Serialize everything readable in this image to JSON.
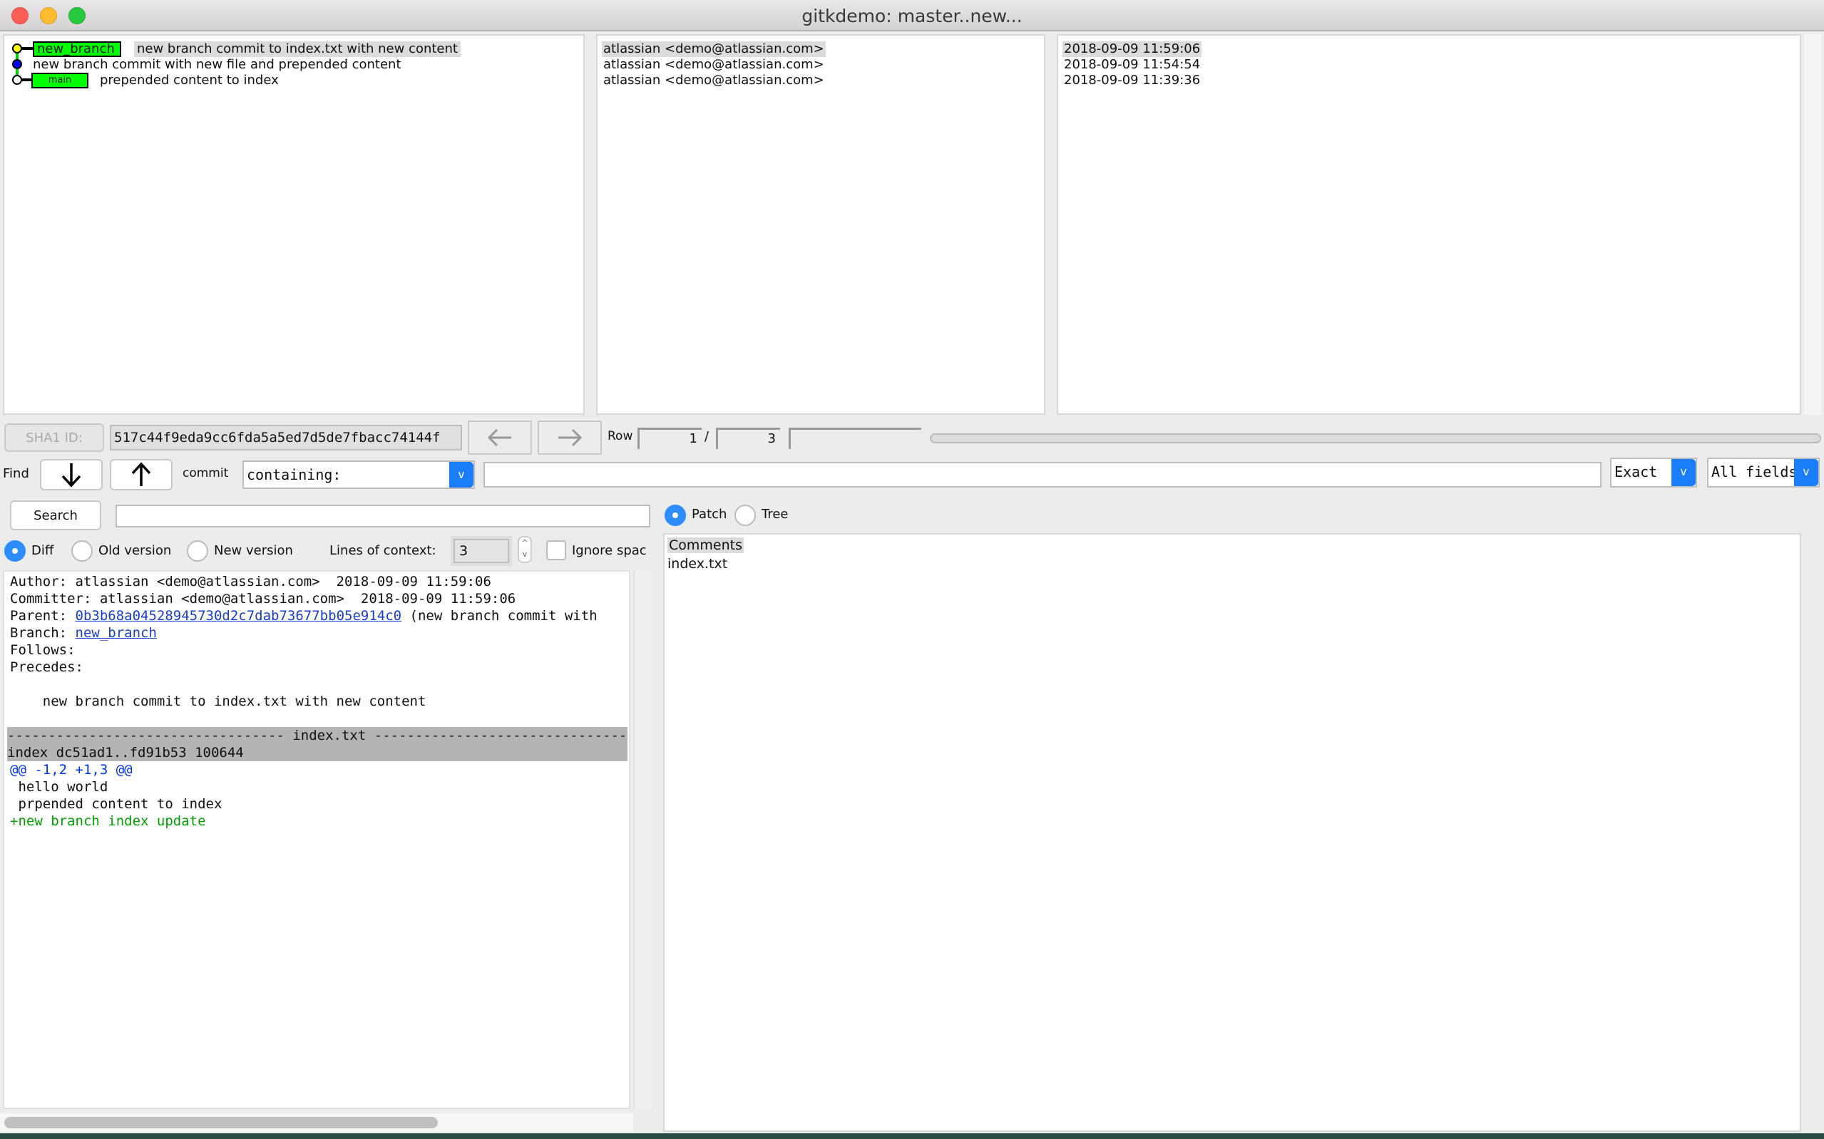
{
  "window": {
    "title": "gitkdemo: master..new...",
    "traffic_lights": [
      {
        "name": "close",
        "color": "#ff5f57"
      },
      {
        "name": "minimize",
        "color": "#febc2e"
      },
      {
        "name": "zoom",
        "color": "#28c840"
      }
    ]
  },
  "history": {
    "commits": [
      {
        "ref": "new_branch",
        "message": "new branch commit to index.txt with new content",
        "author": "atlassian <demo@atlassian.com>",
        "date": "2018-09-09 11:59:06",
        "node_color": "#ffff00",
        "selected": true
      },
      {
        "ref": "",
        "message": "new branch commit with new file and prepended content",
        "author": "atlassian <demo@atlassian.com>",
        "date": "2018-09-09 11:54:54",
        "node_color": "#0000ff",
        "selected": false
      },
      {
        "ref": "main",
        "message": "prepended content to index",
        "author": "atlassian <demo@atlassian.com>",
        "date": "2018-09-09 11:39:36",
        "node_color": "#ffffff",
        "selected": false
      }
    ],
    "branch_label_color": "#00ff00",
    "graph_line_color": "#00cc00"
  },
  "toolbar": {
    "sha1_label": "SHA1 ID:",
    "sha1_value": "517c44f9eda9cc6fda5a5ed7d5de7fbacc74144f",
    "back_icon": "arrow-left-icon",
    "forward_icon": "arrow-right-icon",
    "row_label": "Row",
    "row_current": "1",
    "row_separator": "/",
    "row_total": "3"
  },
  "find": {
    "label": "Find",
    "down_icon": "arrow-down-icon",
    "up_icon": "arrow-up-icon",
    "commit_label": "commit",
    "mode_value": "containing:",
    "query_value": "",
    "match_value": "Exact",
    "fields_value": "All fields"
  },
  "search": {
    "button_label": "Search",
    "input_value": ""
  },
  "diff_options": {
    "modes": [
      {
        "label": "Diff",
        "selected": true
      },
      {
        "label": "Old version",
        "selected": false
      },
      {
        "label": "New version",
        "selected": false
      }
    ],
    "context_label": "Lines of context:",
    "context_value": "3",
    "ignore_space_label": "Ignore spac",
    "ignore_space_checked": false
  },
  "view_toggle": {
    "options": [
      {
        "label": "Patch",
        "selected": true
      },
      {
        "label": "Tree",
        "selected": false
      }
    ]
  },
  "details": {
    "author_line": "Author: atlassian <demo@atlassian.com>  2018-09-09 11:59:06",
    "committer_line": "Committer: atlassian <demo@atlassian.com>  2018-09-09 11:59:06",
    "parent_label": "Parent: ",
    "parent_sha": "0b3b68a04528945730d2c7dab73677bb05e914c0",
    "parent_suffix": " (new branch commit with",
    "branch_label": "Branch: ",
    "branch_value": "new_branch",
    "follows_label": "Follows:",
    "precedes_label": "Precedes:",
    "message": "    new branch commit to index.txt with new content",
    "file_header": "---------------------------------- index.txt ----------------------------------",
    "index_line": "index dc51ad1..fd91b53 100644",
    "hunk_header": "@@ -1,2 +1,3 @@",
    "lines": [
      {
        "text": " hello world",
        "type": "context"
      },
      {
        "text": " prpended content to index",
        "type": "context"
      },
      {
        "text": "+new branch index update",
        "type": "added"
      }
    ],
    "colors": {
      "hunk": "#0033ee",
      "added": "#00a000",
      "header_bg": "#b4b4b4",
      "link": "#1a3dcc"
    }
  },
  "files": {
    "items": [
      "Comments",
      "index.txt"
    ],
    "selected": "Comments"
  }
}
